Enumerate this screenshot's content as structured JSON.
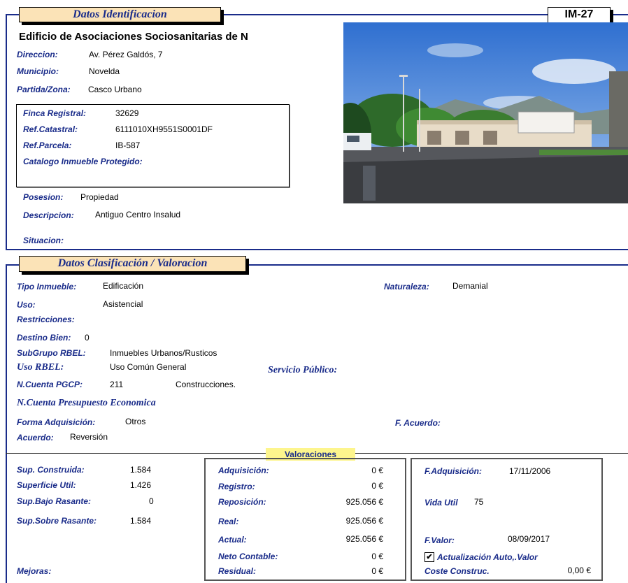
{
  "section1": {
    "tab_title": "Datos Identificacion",
    "code": "IM-27",
    "building_name": "Edificio de Asociaciones Sociosanitarias de N",
    "direccion": {
      "label": "Direccion:",
      "value": "Av. Pérez Galdós, 7"
    },
    "municipio": {
      "label": "Municipio:",
      "value": "Novelda"
    },
    "partida": {
      "label": "Partida/Zona:",
      "value": "Casco Urbano"
    },
    "finca": {
      "label": "Finca Registral:",
      "value": "32629"
    },
    "ref_catastral": {
      "label": "Ref.Catastral:",
      "value": "6111010XH9551S0001DF"
    },
    "ref_parcela": {
      "label": "Ref.Parcela:",
      "value": "IB-587"
    },
    "catalogo": {
      "label": "Catalogo Inmueble Protegido:"
    },
    "posesion": {
      "label": "Posesion:",
      "value": "Propiedad"
    },
    "descripcion": {
      "label": "Descripcion:",
      "value": "Antiguo Centro Insalud"
    },
    "situacion": {
      "label": "Situacion:"
    }
  },
  "section2": {
    "tab_title": "Datos Clasificación / Valoracion",
    "tipo": {
      "label": "Tipo Inmueble:",
      "value": "Edificación"
    },
    "naturaleza": {
      "label": "Naturaleza:",
      "value": "Demanial"
    },
    "uso": {
      "label": "Uso:",
      "value": "Asistencial"
    },
    "restricciones": {
      "label": "Restricciones:"
    },
    "destino": {
      "label": "Destino Bien:",
      "value": "0"
    },
    "subgrupo": {
      "label": "SubGrupo RBEL:",
      "value": "Inmuebles Urbanos/Rusticos"
    },
    "uso_rbel": {
      "label": "Uso RBEL:",
      "value": "Uso Común General"
    },
    "servicio": {
      "label": "Servicio Público:"
    },
    "cuenta_pgcp": {
      "label": "N.Cuenta PGCP:",
      "value": "211",
      "desc": "Construcciones."
    },
    "cuenta_presupuesto": {
      "label": "N.Cuenta Presupuesto Economica"
    },
    "forma": {
      "label": "Forma Adquisición:",
      "value": "Otros"
    },
    "f_acuerdo": {
      "label": "F. Acuerdo:"
    },
    "acuerdo": {
      "label": "Acuerdo:",
      "value": "Reversión"
    }
  },
  "valoraciones": {
    "title": "Valoraciones",
    "left": [
      {
        "label": "Sup. Construida:",
        "value": "1.584"
      },
      {
        "label": "Superficie Util:",
        "value": "1.426"
      },
      {
        "label": "Sup.Bajo Rasante:",
        "value": "0"
      },
      {
        "label": "Sup.Sobre Rasante:",
        "value": "1.584"
      }
    ],
    "mejoras": "Mejoras:",
    "middle": [
      {
        "label": "Adquisición:",
        "value": "0 €"
      },
      {
        "label": "Registro:",
        "value": "0 €"
      },
      {
        "label": "Reposición:",
        "value": "925.056 €"
      },
      {
        "label": "Real:",
        "value": "925.056 €"
      },
      {
        "label": "Actual:",
        "value": "925.056 €"
      },
      {
        "label": "Neto Contable:",
        "value": "0 €"
      },
      {
        "label": "Residual:",
        "value": "0 €"
      }
    ],
    "f_adquisicion": {
      "label": "F.Adquisición:",
      "value": "17/11/2006"
    },
    "vida_util": {
      "label": "Vida Util",
      "value": "75"
    },
    "f_valor": {
      "label": "F.Valor:",
      "value": "08/09/2017"
    },
    "actualizacion": {
      "label": "Actualización Auto,.Valor",
      "checked": true,
      "mark": "✔"
    },
    "coste": {
      "label": "Coste Construc.",
      "value": "0,00 €"
    }
  }
}
